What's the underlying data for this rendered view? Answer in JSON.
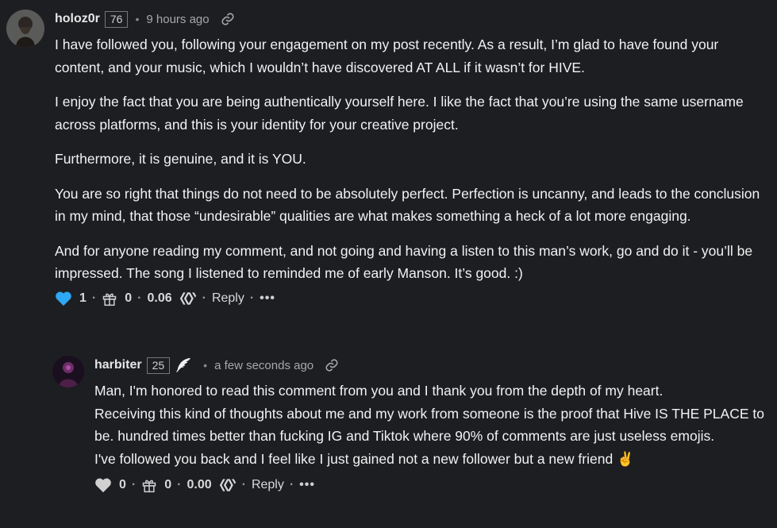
{
  "comments": [
    {
      "author": "holoz0r",
      "reputation": "76",
      "time": "9 hours ago",
      "paragraphs": [
        "I have followed you, following your engagement on my post recently. As a result, I’m glad to have found your content, and your music, which I wouldn’t have discovered AT ALL if it wasn’t for HIVE.",
        "I enjoy the fact that you are being authentically yourself here. I like the fact that you’re using the same username across platforms, and this is your identity for your creative project.",
        "Furthermore, it is genuine, and it is YOU.",
        "You are so right that things do not need to be absolutely perfect. Perfection is uncanny, and leads to the conclusion in my mind, that those “undesirable” qualities are what makes something a heck of a lot more engaging.",
        "And for anyone reading my comment, and not going and having a listen to this man’s work, go and do it - you’ll be impressed. The song I listened to reminded me of early Manson. It’s good. :)"
      ],
      "likes": "1",
      "gifts": "0",
      "payout": "0.06",
      "reply_label": "Reply",
      "more_label": "•••",
      "like_color": "#2ea8f2"
    },
    {
      "author": "harbiter",
      "reputation": "25",
      "time": "a few seconds ago",
      "paragraphs": [
        "Man, I'm honored to read this comment from you and I thank you from the depth of my heart.",
        "Receiving this kind of thoughts about me and my work from someone is the proof that Hive IS THE PLACE to be. hundred times better than fucking IG and Tiktok where 90% of comments are just useless emojis.",
        "I've followed you back and I feel like I just gained not a new follower but a new friend ✌️"
      ],
      "likes": "0",
      "gifts": "0",
      "payout": "0.00",
      "reply_label": "Reply",
      "more_label": "•••",
      "like_color": "#d0d0d0"
    }
  ],
  "icons": {
    "like": "heart-icon",
    "gift": "gift-icon",
    "currency": "hive-logo-icon",
    "permalink": "link-icon",
    "badge": "feather-icon"
  }
}
